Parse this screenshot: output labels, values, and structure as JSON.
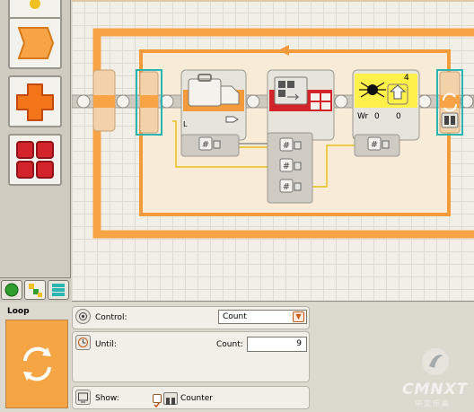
{
  "palette": {
    "tabs": [
      "common",
      "complete",
      "custom"
    ]
  },
  "canvas": {
    "loop_counter_label": "4",
    "blocks": {
      "bag_port_label": "L",
      "sensor_port_label": "Wr",
      "sensor_val1": "0",
      "sensor_val2": "0",
      "hash_glyph": "#"
    }
  },
  "panel": {
    "title": "Loop",
    "control_label": "Control:",
    "control_value": "Count",
    "until_label": "Until:",
    "count_label": "Count:",
    "count_value": "9",
    "show_label": "Show:",
    "counter_label": "Counter"
  },
  "watermark": {
    "brand": "CMNXT",
    "subtitle": "中文乐高"
  },
  "colors": {
    "loop_orange": "#f7a447",
    "beam_orange": "#f39a3a",
    "block_red": "#d3242b",
    "sensor_yellow": "#fff04a",
    "wire_yellow": "#e9c01a",
    "wire_gray": "#8b8b8b",
    "teal": "#2bb5b0"
  }
}
